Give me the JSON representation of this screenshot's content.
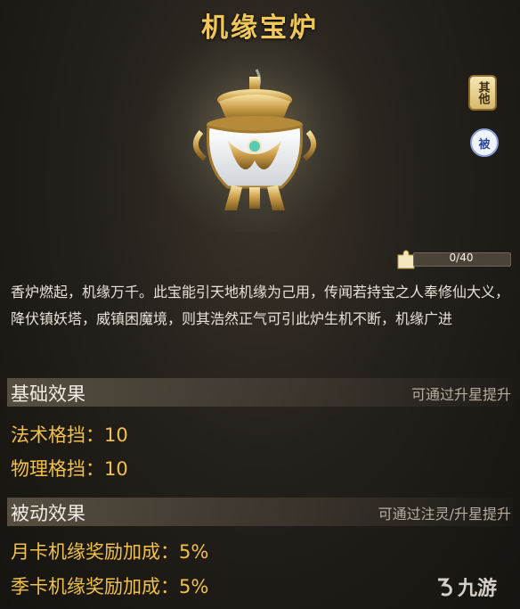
{
  "title": "机缘宝炉",
  "tags": {
    "other": "其他",
    "passive": "被"
  },
  "progress": {
    "text": "0/40",
    "value": 0,
    "max": 40
  },
  "description": "香炉燃起，机缘万千。此宝能引天地机缘为己用，传闻若持宝之人奉修仙大义，降伏镇妖塔，威镇困魔境，则其浩然正气可引此炉生机不断，机缘广进",
  "base": {
    "label": "基础效果",
    "hint": "可通过升星提升",
    "stats": [
      "法术格挡：10",
      "物理格挡：10"
    ]
  },
  "passive": {
    "label": "被动效果",
    "hint": "可通过注灵/升星提升",
    "stats": [
      "月卡机缘奖励加成：5%",
      "季卡机缘奖励加成：5%"
    ]
  },
  "watermark": "九游",
  "colors": {
    "title": "#f1c75a",
    "stat": "#f1c148",
    "progress_fill": "#c9a45a"
  },
  "icons": [
    "incense-burner-icon",
    "puzzle-piece-icon",
    "jiuyou-logo-icon"
  ]
}
